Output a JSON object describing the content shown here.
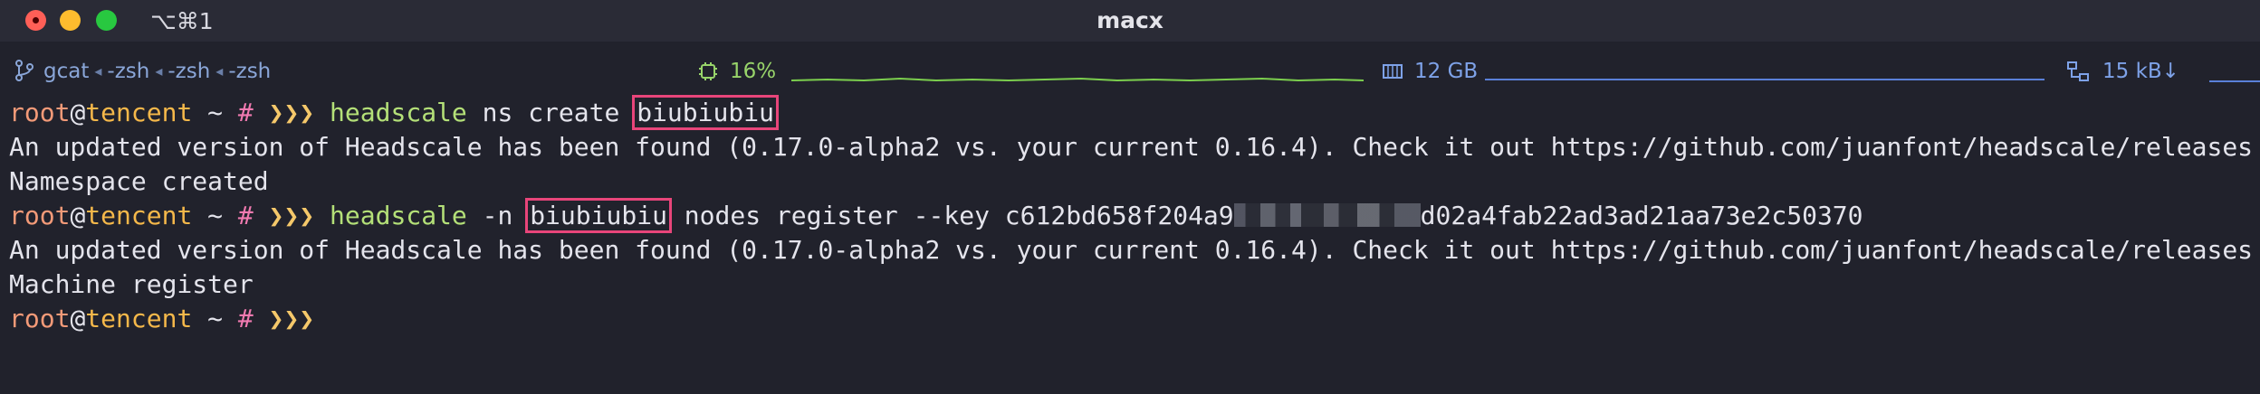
{
  "titlebar": {
    "shortcut": "⌥⌘1",
    "title": "macx"
  },
  "statusbar": {
    "tabs": [
      "gcat",
      "-zsh",
      "-zsh",
      "-zsh"
    ],
    "cpu": "16%",
    "memory": "12 GB",
    "network": "15 kB↓"
  },
  "terminal": {
    "prompt": {
      "user": "root",
      "at": "@",
      "host": "tencent",
      "path": "~",
      "symbol": "#",
      "arrows": "❯❯❯"
    },
    "lines": [
      {
        "type": "command",
        "cmd": "headscale",
        "pre": " ns create ",
        "highlight": "biubiubiu",
        "post": ""
      },
      {
        "type": "output",
        "text": "An updated version of Headscale has been found (0.17.0-alpha2 vs. your current 0.16.4). Check it out https://github.com/juanfont/headscale/releases"
      },
      {
        "type": "output",
        "text": "Namespace created"
      },
      {
        "type": "command",
        "cmd": "headscale",
        "pre": " -n ",
        "highlight": "biubiubiu",
        "mid": " nodes register --key c612bd658f204a9",
        "post": "d02a4fab22ad3ad21aa73e2c50370"
      },
      {
        "type": "output",
        "text": "An updated version of Headscale has been found (0.17.0-alpha2 vs. your current 0.16.4). Check it out https://github.com/juanfont/headscale/releases"
      },
      {
        "type": "output",
        "text": "Machine register"
      }
    ]
  },
  "colors": {
    "background": "#21222c",
    "highlight_box": "#e8457a",
    "command": "#b4e078",
    "host": "#f5b84a",
    "user": "#f39a78"
  }
}
